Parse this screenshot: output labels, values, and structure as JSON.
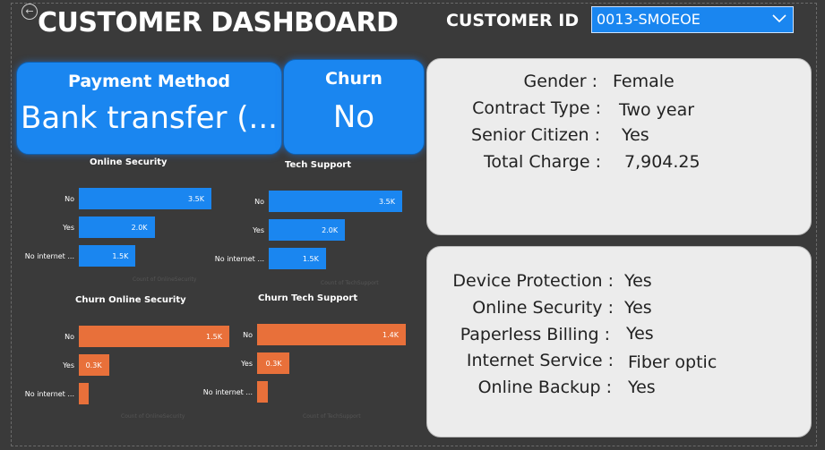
{
  "header": {
    "title": "CUSTOMER DASHBOARD",
    "customer_id_label": "CUSTOMER ID",
    "customer_id_value": "0013-SMOEOE"
  },
  "cards": {
    "payment_label": "Payment Method",
    "payment_value": "Bank transfer (...",
    "churn_label": "Churn",
    "churn_value": "No"
  },
  "details_top": [
    {
      "label": "Gender :",
      "value": "Female"
    },
    {
      "label": "Contract Type :",
      "value": "Two year"
    },
    {
      "label": "Senior Citizen :",
      "value": "Yes"
    },
    {
      "label": "Total Charge :",
      "value": "7,904.25"
    }
  ],
  "details_bottom": [
    {
      "label": "Device Protection :",
      "value": "Yes"
    },
    {
      "label": "Online Security :",
      "value": "Yes"
    },
    {
      "label": "Paperless Billing :",
      "value": "Yes"
    },
    {
      "label": "Internet Service :",
      "value": "Fiber optic"
    },
    {
      "label": "Online Backup :",
      "value": "Yes"
    }
  ],
  "colors": {
    "blue": "#1a86f0",
    "orange": "#e8703a"
  },
  "chart_data": [
    {
      "type": "bar",
      "title": "Online Security",
      "categories": [
        "No",
        "Yes",
        "No internet ..."
      ],
      "values": [
        3.5,
        2.0,
        1.5
      ],
      "value_labels": [
        "3.5K",
        "2.0K",
        "1.5K"
      ],
      "xlabel": "Count of OnlineSecurity",
      "color": "#1a86f0"
    },
    {
      "type": "bar",
      "title": "Tech Support",
      "categories": [
        "No",
        "Yes",
        "No internet ..."
      ],
      "values": [
        3.5,
        2.0,
        1.5
      ],
      "value_labels": [
        "3.5K",
        "2.0K",
        "1.5K"
      ],
      "xlabel": "Count of TechSupport",
      "color": "#1a86f0"
    },
    {
      "type": "bar",
      "title": "Churn Online Security",
      "categories": [
        "No",
        "Yes",
        "No internet ..."
      ],
      "values": [
        1.5,
        0.3,
        0.1
      ],
      "value_labels": [
        "1.5K",
        "0.3K",
        ""
      ],
      "xlabel": "Count of OnlineSecurity",
      "color": "#e8703a"
    },
    {
      "type": "bar",
      "title": "Churn Tech Support",
      "categories": [
        "No",
        "Yes",
        "No internet ..."
      ],
      "values": [
        1.4,
        0.3,
        0.1
      ],
      "value_labels": [
        "1.4K",
        "0.3K",
        ""
      ],
      "xlabel": "Count of TechSupport",
      "color": "#e8703a"
    }
  ]
}
